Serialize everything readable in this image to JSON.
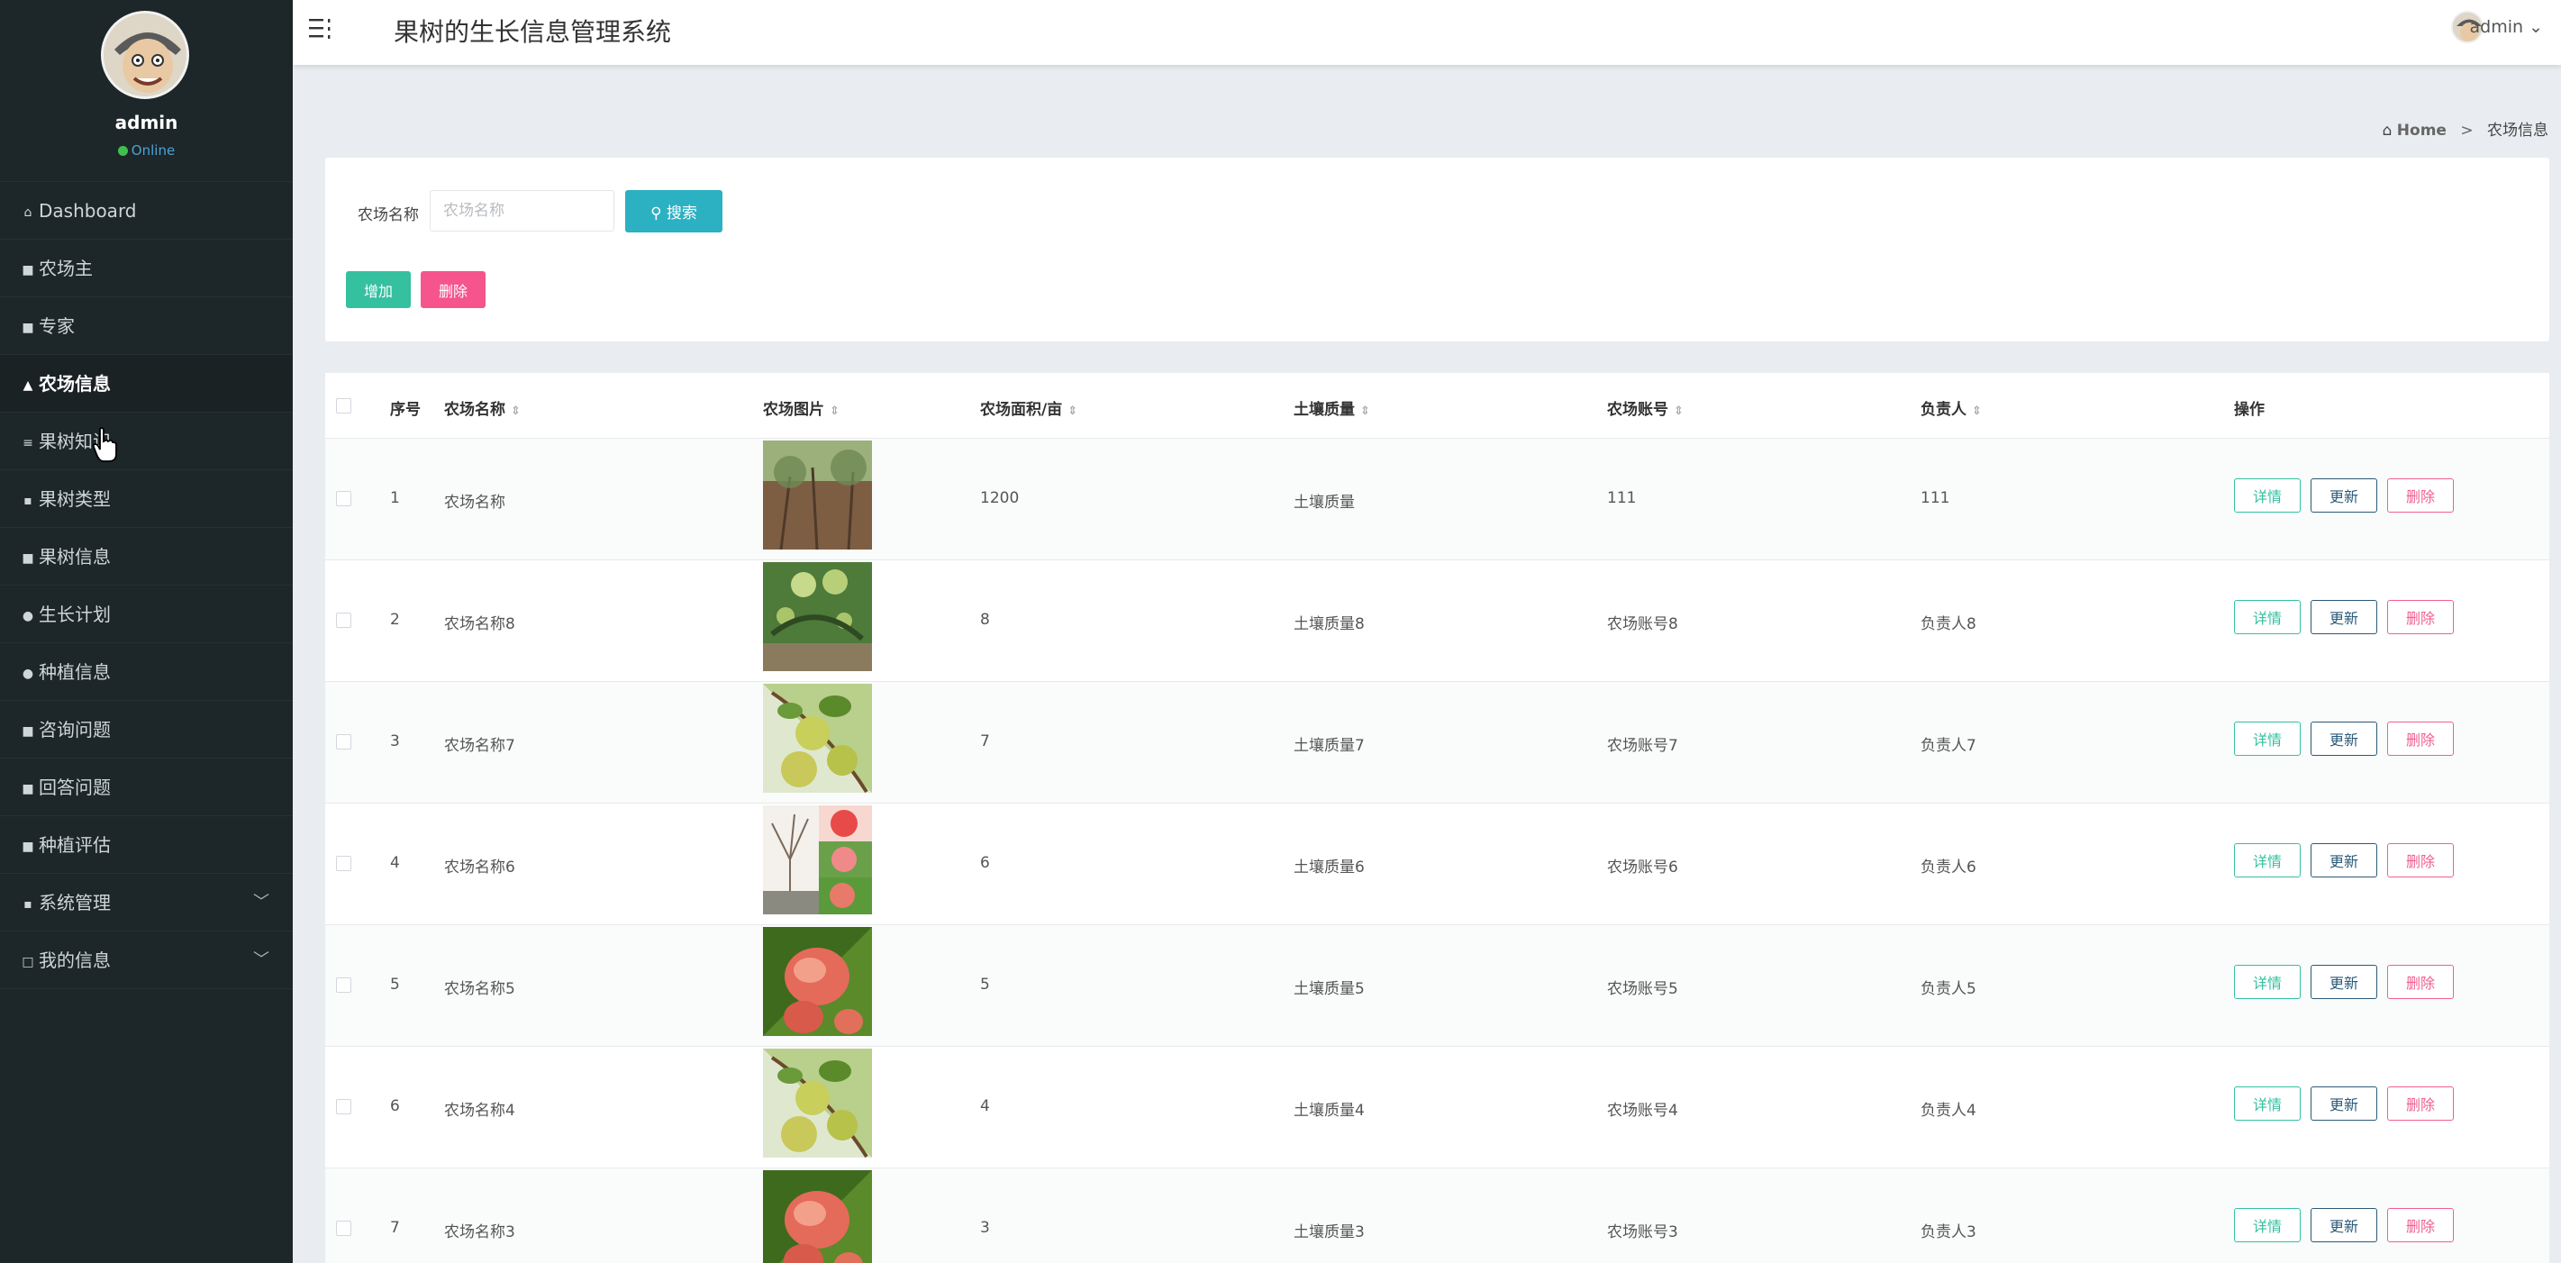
{
  "sidebar": {
    "user": {
      "name": "admin",
      "status": "Online"
    },
    "items": [
      {
        "label": "Dashboard",
        "icon": "home-icon",
        "glyph": "⌂"
      },
      {
        "label": "农场主",
        "icon": "users-icon",
        "glyph": "■"
      },
      {
        "label": "专家",
        "icon": "id-card-icon",
        "glyph": "■"
      },
      {
        "label": "农场信息",
        "icon": "building-icon",
        "glyph": "▲",
        "active": true
      },
      {
        "label": "果树知识",
        "icon": "list-icon",
        "glyph": "≡"
      },
      {
        "label": "果树类型",
        "icon": "grid-icon",
        "glyph": "▪"
      },
      {
        "label": "果树信息",
        "icon": "lock-icon",
        "glyph": "■"
      },
      {
        "label": "生长计划",
        "icon": "user-icon",
        "glyph": "●"
      },
      {
        "label": "种植信息",
        "icon": "location-icon",
        "glyph": "●"
      },
      {
        "label": "咨询问题",
        "icon": "document-icon",
        "glyph": "■"
      },
      {
        "label": "回答问题",
        "icon": "chat-icon",
        "glyph": "■"
      },
      {
        "label": "种植评估",
        "icon": "clipboard-icon",
        "glyph": "■"
      },
      {
        "label": "系统管理",
        "icon": "grid-icon",
        "glyph": "▪",
        "chevron": "﹀"
      },
      {
        "label": "我的信息",
        "icon": "card-icon",
        "glyph": "□",
        "chevron": "﹀"
      }
    ]
  },
  "header": {
    "title": "果树的生长信息管理系统",
    "user_name": "admin",
    "user_caret": "⌄"
  },
  "breadcrumb": {
    "home": "Home",
    "separator": ">",
    "current": "农场信息"
  },
  "search": {
    "label": "农场名称",
    "placeholder": "农场名称",
    "value": "",
    "button_label": "搜索",
    "add_label": "增加",
    "delete_label": "删除"
  },
  "table": {
    "headers": {
      "index": "序号",
      "name": "农场名称",
      "image": "农场图片",
      "area": "农场面积/亩",
      "soil": "土壤质量",
      "account": "农场账号",
      "manager": "负责人",
      "actions": "操作"
    },
    "sort_glyph": "⇕",
    "action_labels": {
      "detail": "详情",
      "update": "更新",
      "remove": "删除"
    },
    "rows": [
      {
        "index": "1",
        "name": "农场名称",
        "area": "1200",
        "soil": "土壤质量",
        "account": "111",
        "manager": "111",
        "image": "orchard"
      },
      {
        "index": "2",
        "name": "农场名称8",
        "area": "8",
        "soil": "土壤质量8",
        "account": "农场账号8",
        "manager": "负责人8",
        "image": "pear-tree"
      },
      {
        "index": "3",
        "name": "农场名称7",
        "area": "7",
        "soil": "土壤质量7",
        "account": "农场账号7",
        "manager": "负责人7",
        "image": "green-fruit"
      },
      {
        "index": "4",
        "name": "农场名称6",
        "area": "6",
        "soil": "土壤质量6",
        "account": "农场账号6",
        "manager": "负责人6",
        "image": "peach-collage"
      },
      {
        "index": "5",
        "name": "农场名称5",
        "area": "5",
        "soil": "土壤质量5",
        "account": "农场账号5",
        "manager": "负责人5",
        "image": "peach"
      },
      {
        "index": "6",
        "name": "农场名称4",
        "area": "4",
        "soil": "土壤质量4",
        "account": "农场账号4",
        "manager": "负责人4",
        "image": "green-fruit"
      },
      {
        "index": "7",
        "name": "农场名称3",
        "area": "3",
        "soil": "土壤质量3",
        "account": "农场账号3",
        "manager": "负责人3",
        "image": "peach"
      }
    ]
  }
}
